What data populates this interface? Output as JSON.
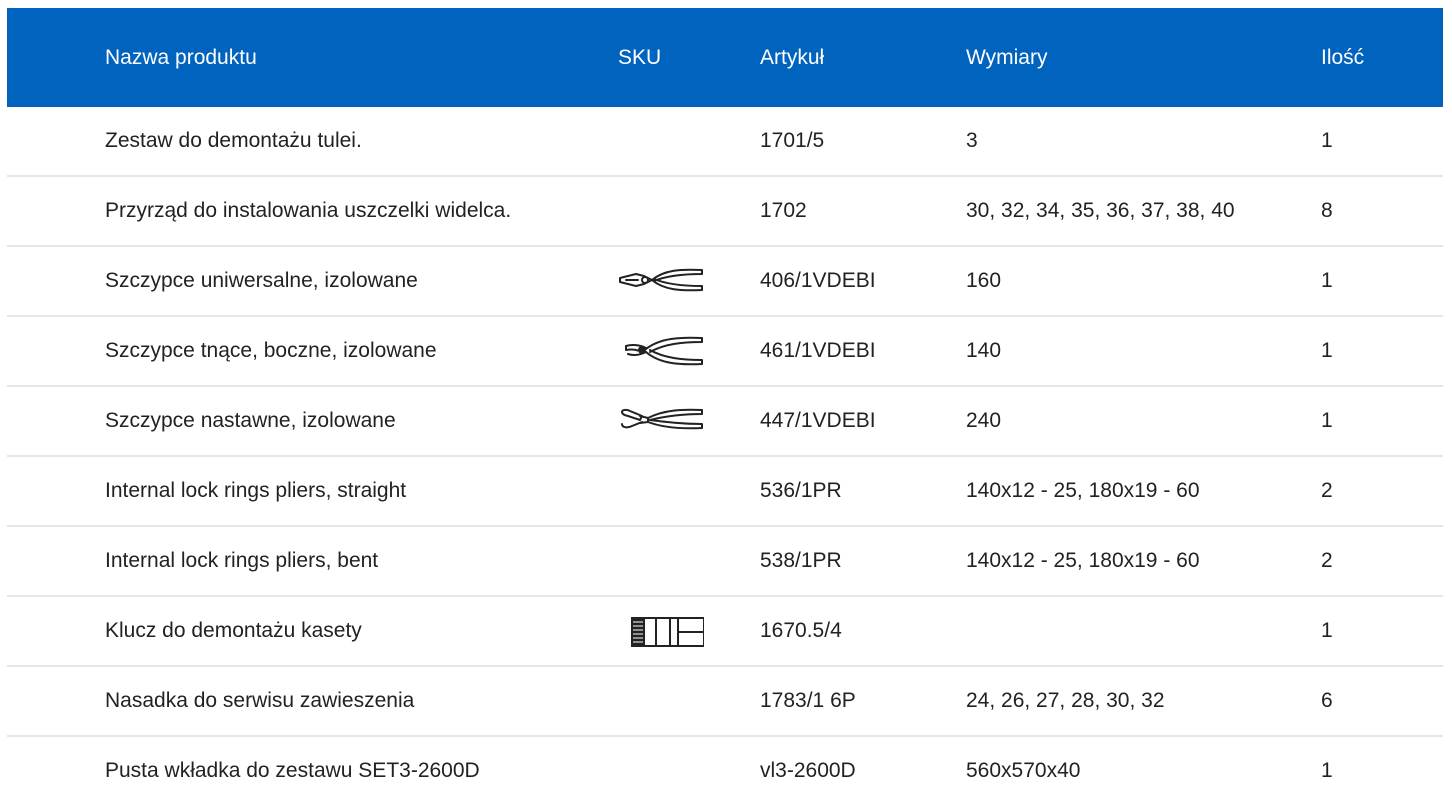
{
  "header": {
    "name": "Nazwa produktu",
    "sku": "SKU",
    "article": "Artykuł",
    "dimensions": "Wymiary",
    "quantity": "Ilość"
  },
  "colors": {
    "header_bg": "#0064be",
    "header_text": "#ffffff",
    "row_divider": "#e6e6e6"
  },
  "rows": [
    {
      "name": "Zestaw do demontażu tulei.",
      "sku_icon": "",
      "article": "1701/5",
      "dimensions": "3",
      "quantity": "1"
    },
    {
      "name": "Przyrząd do instalowania uszczelki widelca.",
      "sku_icon": "",
      "article": "1702",
      "dimensions": "30, 32, 34, 35, 36, 37, 38, 40",
      "quantity": "8"
    },
    {
      "name": "Szczypce uniwersalne, izolowane",
      "sku_icon": "combination-pliers-icon",
      "article": "406/1VDEBI",
      "dimensions": "160",
      "quantity": "1"
    },
    {
      "name": "Szczypce tnące, boczne, izolowane",
      "sku_icon": "side-cutter-pliers-icon",
      "article": "461/1VDEBI",
      "dimensions": "140",
      "quantity": "1"
    },
    {
      "name": "Szczypce nastawne, izolowane",
      "sku_icon": "adjustable-pliers-icon",
      "article": "447/1VDEBI",
      "dimensions": "240",
      "quantity": "1"
    },
    {
      "name": "Internal lock rings pliers, straight",
      "sku_icon": "",
      "article": "536/1PR",
      "dimensions": "140x12 - 25, 180x19 - 60",
      "quantity": "2"
    },
    {
      "name": "Internal lock rings pliers, bent",
      "sku_icon": "",
      "article": "538/1PR",
      "dimensions": "140x12 - 25, 180x19 - 60",
      "quantity": "2"
    },
    {
      "name": "Klucz do demontażu kasety",
      "sku_icon": "cassette-tool-icon",
      "article": "1670.5/4",
      "dimensions": "",
      "quantity": "1"
    },
    {
      "name": "Nasadka do serwisu zawieszenia",
      "sku_icon": "",
      "article": "1783/1 6P",
      "dimensions": "24, 26, 27, 28, 30, 32",
      "quantity": "6"
    },
    {
      "name": "Pusta wkładka do zestawu SET3-2600D",
      "sku_icon": "",
      "article": "vl3-2600D",
      "dimensions": "560x570x40",
      "quantity": "1"
    }
  ]
}
